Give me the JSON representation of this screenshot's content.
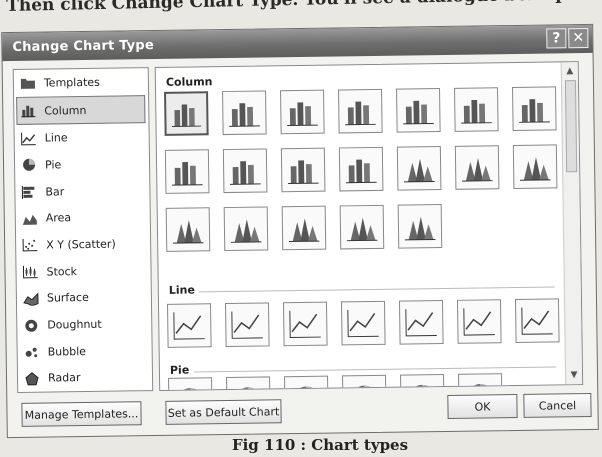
{
  "top_caption": "Then click Change Chart Type. You'll see a dialogue box appear",
  "dialog": {
    "title": "Change Chart Type",
    "help_button": "?",
    "close_button": "✕"
  },
  "sidebar": {
    "items": [
      {
        "label": "Templates",
        "icon": "folder-icon"
      },
      {
        "label": "Column",
        "icon": "column-chart-icon",
        "selected": true
      },
      {
        "label": "Line",
        "icon": "line-chart-icon"
      },
      {
        "label": "Pie",
        "icon": "pie-chart-icon"
      },
      {
        "label": "Bar",
        "icon": "bar-chart-icon"
      },
      {
        "label": "Area",
        "icon": "area-chart-icon"
      },
      {
        "label": "X Y (Scatter)",
        "icon": "scatter-chart-icon"
      },
      {
        "label": "Stock",
        "icon": "stock-chart-icon"
      },
      {
        "label": "Surface",
        "icon": "surface-chart-icon"
      },
      {
        "label": "Doughnut",
        "icon": "doughnut-chart-icon"
      },
      {
        "label": "Bubble",
        "icon": "bubble-chart-icon"
      },
      {
        "label": "Radar",
        "icon": "radar-chart-icon"
      }
    ]
  },
  "gallery": {
    "sections": [
      {
        "title": "Column",
        "thumb_count": 19
      },
      {
        "title": "Line",
        "thumb_count": 7
      },
      {
        "title": "Pie",
        "thumb_count": 6
      }
    ]
  },
  "buttons": {
    "manage_templates": "Manage Templates...",
    "set_default": "Set as Default Chart",
    "ok": "OK",
    "cancel": "Cancel"
  },
  "figure_caption": "Fig 110 : Chart types"
}
